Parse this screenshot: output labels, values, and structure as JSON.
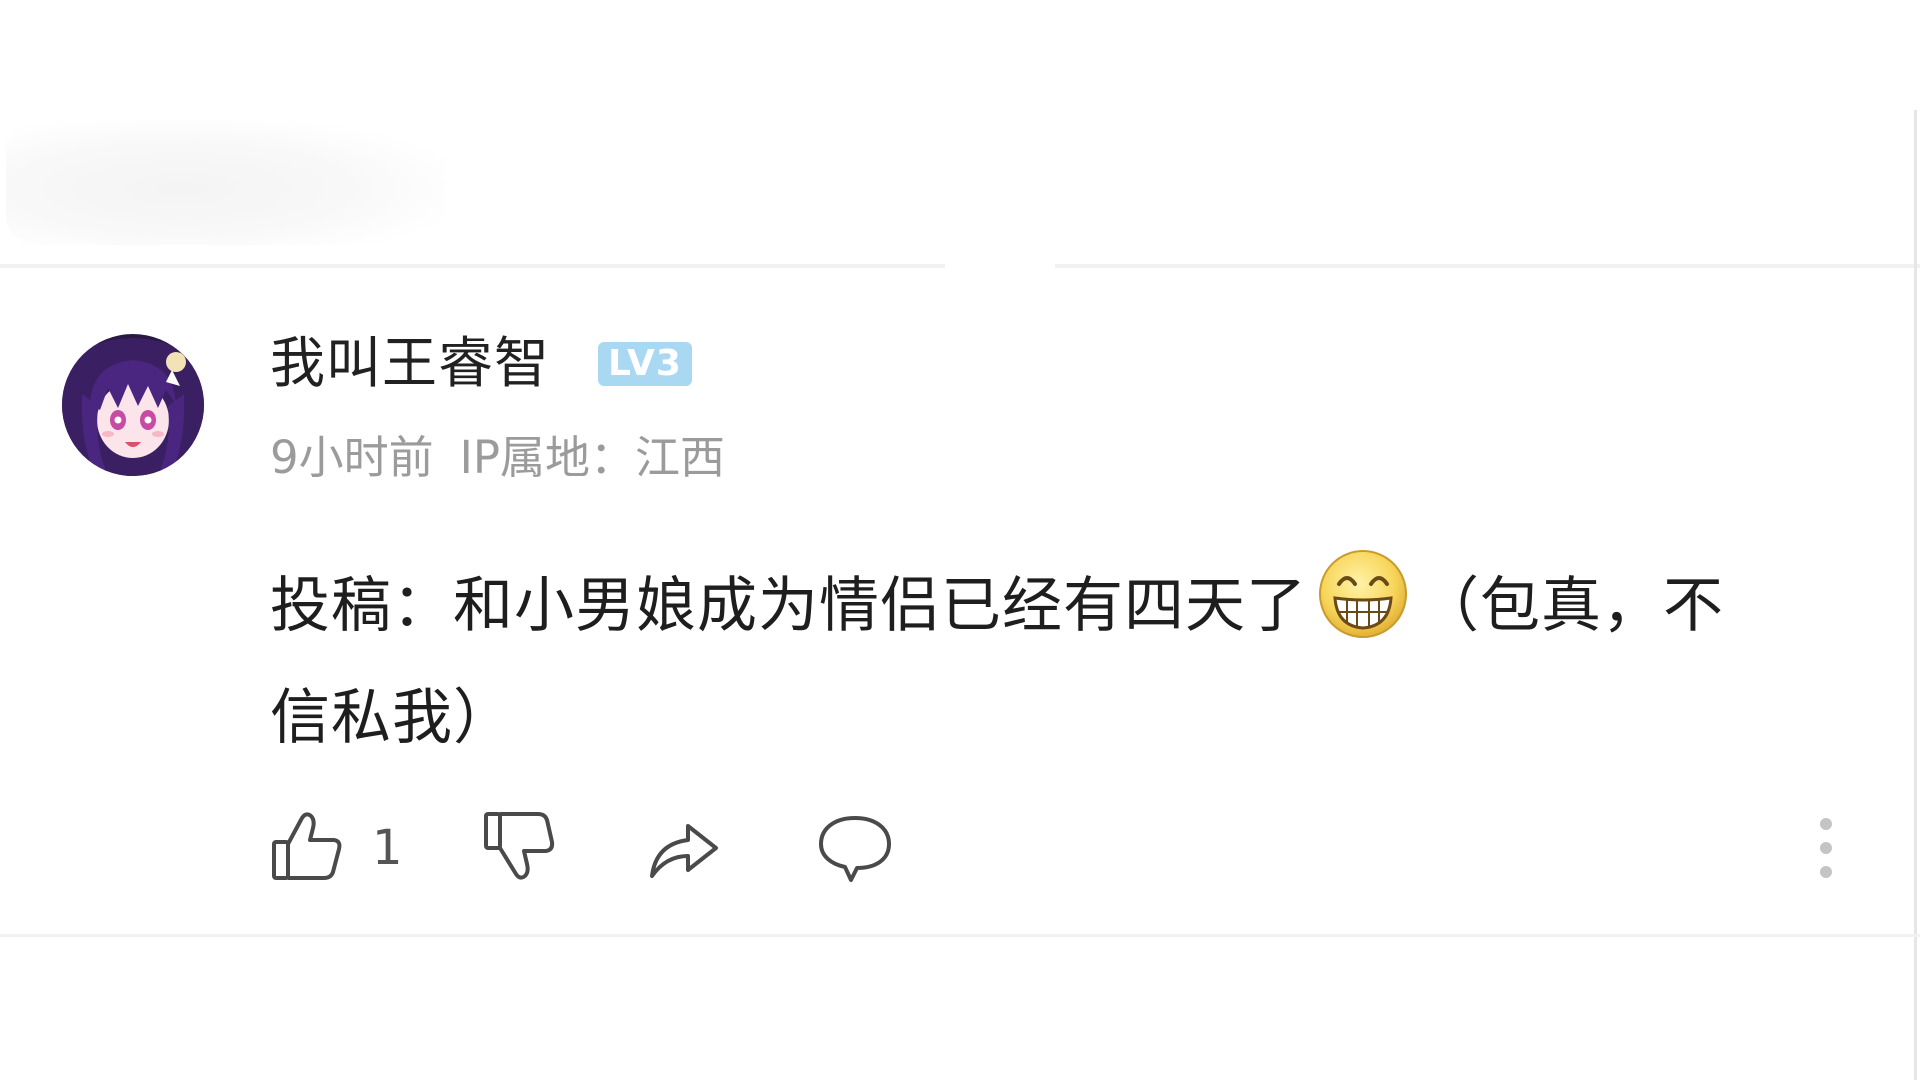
{
  "comment": {
    "username": "我叫王睿智",
    "level_badge": "LV3",
    "time_ago": "9小时前",
    "ip_location": "IP属地：江西",
    "text_before_emoji": "投稿：和小男娘成为情侣已经有四天了",
    "emoji": "grinning-face-emoji",
    "text_after_emoji": "（包真，不信私我）",
    "like_count": "1"
  },
  "icons": {
    "like": "thumbs-up-icon",
    "dislike": "thumbs-down-icon",
    "share": "share-arrow-icon",
    "reply": "speech-bubble-icon",
    "more": "vertical-dots-icon"
  },
  "colors": {
    "username": "#212121",
    "meta_text": "#9b9b9b",
    "badge_background": "#a9d8f3",
    "icon_stroke": "#4a4a4a",
    "divider": "#f1f1f1"
  }
}
